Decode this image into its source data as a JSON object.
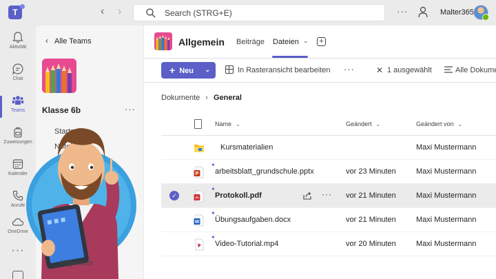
{
  "titlebar": {
    "search_placeholder": "Search (STRG+E)",
    "org_name": "Malter365",
    "more_label": "···"
  },
  "rail": {
    "items": [
      {
        "label": "Aktivität",
        "icon": "bell-icon"
      },
      {
        "label": "Chat",
        "icon": "chat-icon"
      },
      {
        "label": "Teams",
        "icon": "teams-icon",
        "active": true
      },
      {
        "label": "Zuweisungen",
        "icon": "backpack-icon"
      },
      {
        "label": "Kalender",
        "icon": "calendar-icon"
      },
      {
        "label": "Anrufe",
        "icon": "phone-icon"
      },
      {
        "label": "OneDrive",
        "icon": "cloud-icon"
      }
    ],
    "more_label": "···"
  },
  "panel": {
    "back_label": "Alle Teams",
    "team_name": "Klasse 6b",
    "more_label": "···",
    "channels": [
      "Startseite",
      "Notebook",
      "Allgemein"
    ]
  },
  "header": {
    "channel_title": "Allgemein",
    "tabs": [
      {
        "label": "Beiträge"
      },
      {
        "label": "Dateien",
        "active": true
      }
    ]
  },
  "toolbar": {
    "new_label": "Neu",
    "grid_edit_label": "In Rasteransicht bearbeiten",
    "more_label": "···",
    "selected_label": "1 ausgewählt",
    "all_docs_label": "Alle Dokume"
  },
  "breadcrumb": {
    "root": "Dokumente",
    "current": "General"
  },
  "table": {
    "columns": [
      "Name",
      "Geändert",
      "Geändert von"
    ],
    "rows": [
      {
        "name": "Kursmaterialien",
        "modified": "",
        "modified_by": "Maxi Mustermann",
        "type": "folder"
      },
      {
        "name": "arbeitsblatt_grundschule.pptx",
        "modified": "vor 23 Minuten",
        "modified_by": "Maxi Mustermann",
        "type": "pptx"
      },
      {
        "name": "Protokoll.pdf",
        "modified": "vor 21 Minuten",
        "modified_by": "Maxi Mustermann",
        "type": "pdf",
        "selected": true
      },
      {
        "name": "Übungsaufgaben.docx",
        "modified": "vor 21 Minuten",
        "modified_by": "Maxi Mustermann",
        "type": "docx"
      },
      {
        "name": "Video-Tutorial.mp4",
        "modified": "vor 20 Minuten",
        "modified_by": "Maxi Mustermann",
        "type": "mp4"
      }
    ]
  },
  "colors": {
    "accent": "#5b5fc7",
    "tile": "#e84a92",
    "pptx": "#c43e1c",
    "pdf": "#d13438",
    "docx": "#185abd",
    "folder": "#ffb900"
  }
}
